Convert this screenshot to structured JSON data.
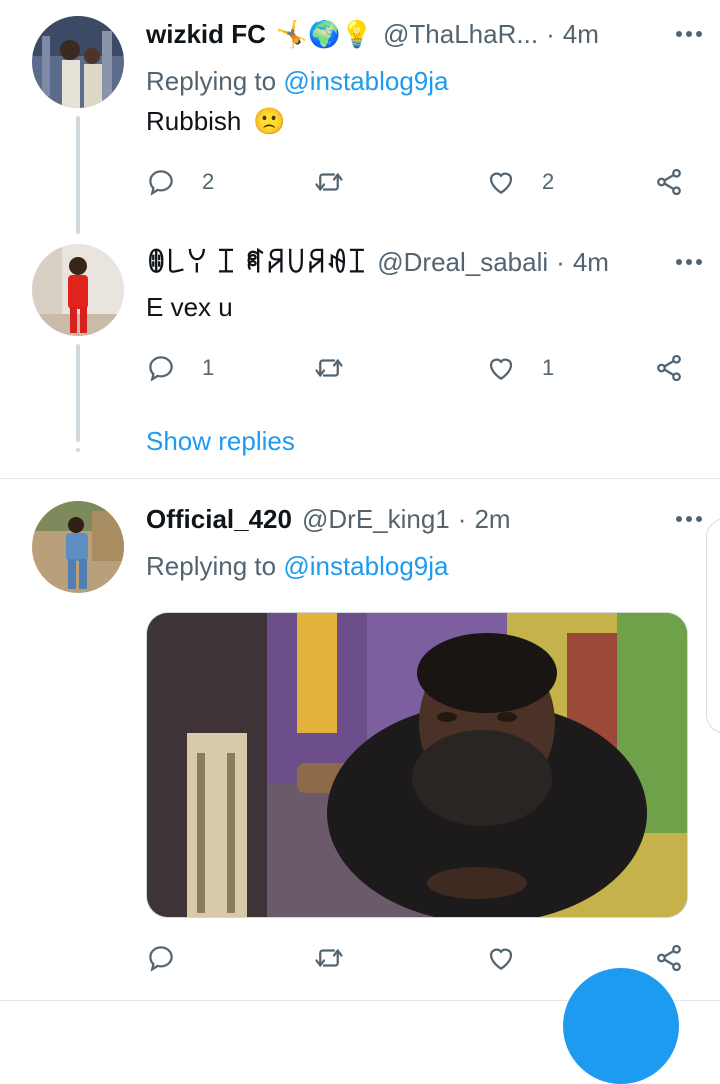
{
  "tweets": [
    {
      "name": "wizkid FC",
      "name_emojis": "🤸🌍💡",
      "handle": "@ThaLhaR...",
      "time": "4m",
      "replying_prefix": "Replying to",
      "replying_to": "@instablog9ja",
      "text": "Rubbish",
      "emoji": "🙁",
      "reply_count": "2",
      "like_count": "2"
    },
    {
      "name": "ꂦ꒒ꌩ ꀤ ꈘꋪ꒤ꋪꆂꀤ",
      "handle": "@Dreal_sabali",
      "time": "4m",
      "text": "E vex u",
      "reply_count": "1",
      "like_count": "1"
    },
    {
      "name": "Official_420",
      "handle": "@DrE_king1",
      "time": "2m",
      "replying_prefix": "Replying to",
      "replying_to": "@instablog9ja"
    }
  ],
  "show_replies": "Show replies",
  "separator": "·",
  "colors": {
    "link": "#1d9bf0",
    "secondary_text": "#536471",
    "thread_line": "#cfd9de",
    "fab": "#1d9bf0"
  },
  "icons": [
    "more-icon",
    "reply-icon",
    "retweet-icon",
    "like-icon",
    "share-icon"
  ]
}
